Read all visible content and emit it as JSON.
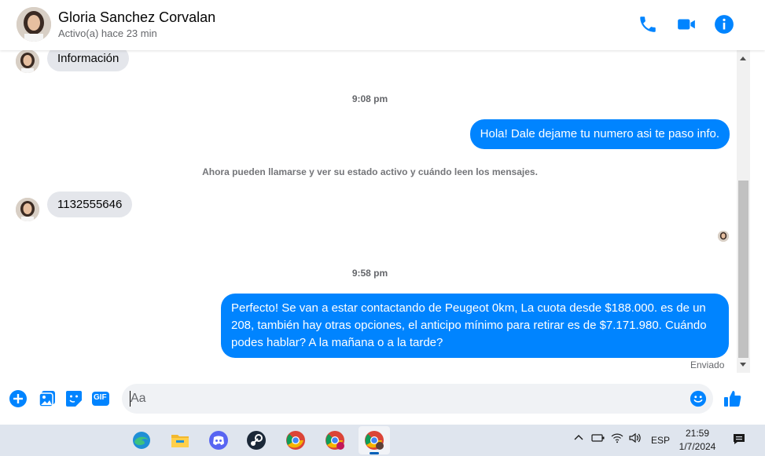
{
  "header": {
    "contact_name": "Gloria Sanchez Corvalan",
    "status": "Activo(a) hace 23 min",
    "icons": [
      "phone-icon",
      "video-icon",
      "info-icon"
    ]
  },
  "messages": {
    "info_label": "Información",
    "time_1": "9:08 pm",
    "out_1": "Hola! Dale dejame tu numero  asi te paso info.",
    "system_notice": "Ahora pueden llamarse y ver su estado activo y cuándo leen los mensajes.",
    "in_number": "1132555646",
    "time_2": "9:58 pm",
    "out_2": "Perfecto!  Se van a estar contactando de Peugeot 0km, La cuota desde $188.000. es de un 208, también hay otras opciones, el anticipo mínimo para retirar es de $7.171.980. Cuándo podes hablar? A la mañana o a la tarde?",
    "sent_status": "Enviado"
  },
  "composer": {
    "placeholder": "Aa",
    "icons": [
      "plus-icon",
      "gallery-icon",
      "sticker-icon",
      "gif-icon",
      "emoji-icon",
      "like-icon"
    ],
    "gif_label": "GIF"
  },
  "taskbar": {
    "apps": [
      "edge-icon",
      "file-explorer-icon",
      "discord-icon",
      "steam-icon",
      "chrome-icon",
      "chrome-profile-icon",
      "chrome-profile-active-icon"
    ],
    "language": "ESP",
    "time": "21:59",
    "date": "1/7/2024"
  },
  "colors": {
    "accent": "#0084ff",
    "incoming_bubble": "#e4e6eb",
    "taskbar": "#dfe5ee"
  }
}
